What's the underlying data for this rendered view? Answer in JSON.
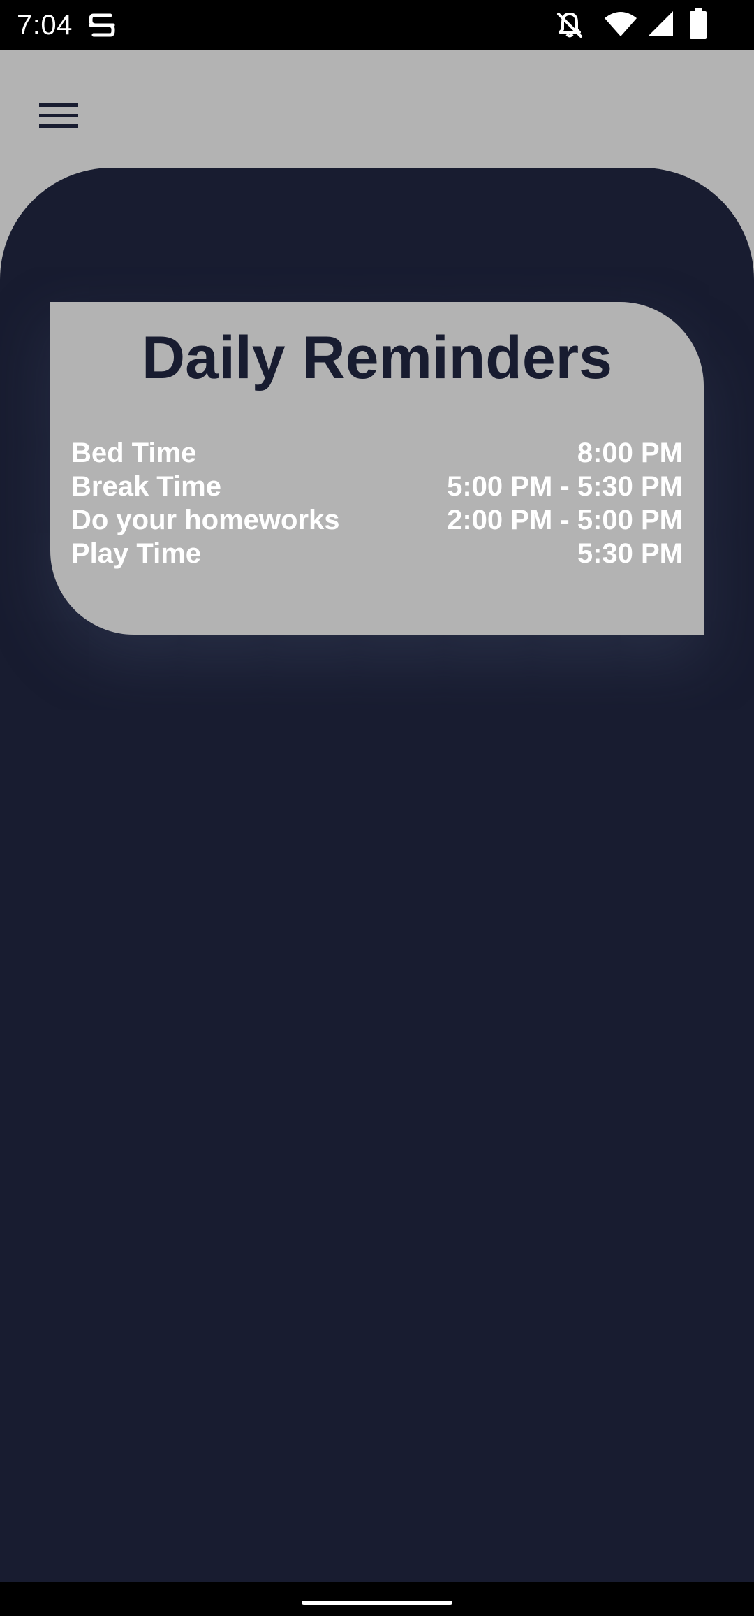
{
  "status_bar": {
    "time": "7:04",
    "icons": [
      "app-notification-icon",
      "notifications-off-icon",
      "wifi-icon",
      "cellular-signal-icon",
      "battery-icon"
    ]
  },
  "app_bar": {
    "menu_icon": "hamburger-menu-icon"
  },
  "reminders": {
    "title": "Daily Reminders",
    "items": [
      {
        "label": "Bed Time",
        "time": "8:00 PM"
      },
      {
        "label": "Break Time",
        "time": "5:00 PM - 5:30 PM"
      },
      {
        "label": "Do your homeworks",
        "time": "2:00 PM - 5:00 PM"
      },
      {
        "label": "Play Time",
        "time": "5:30 PM"
      }
    ]
  },
  "colors": {
    "dark_navy": "#181c30",
    "gray": "#b3b3b3",
    "text_white": "#ffffff"
  }
}
